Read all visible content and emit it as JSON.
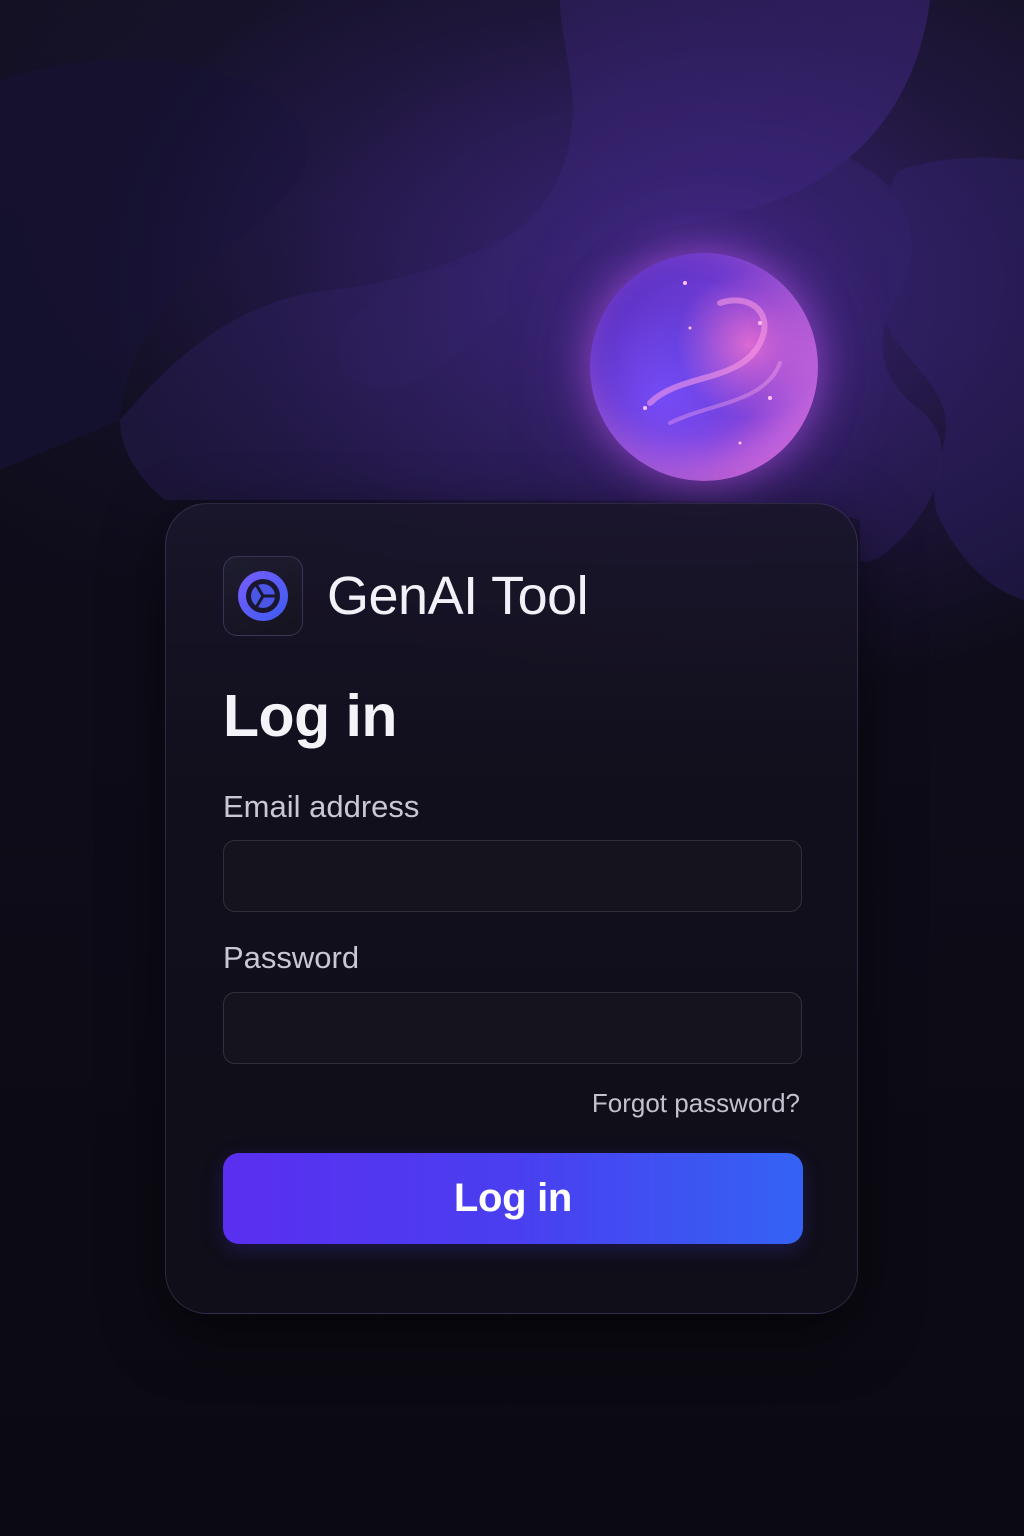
{
  "brand": {
    "name": "GenAI Tool",
    "logo_icon": "aperture-logo-icon"
  },
  "login_form": {
    "title": "Log in",
    "email_label": "Email address",
    "email_value": "",
    "password_label": "Password",
    "password_value": "",
    "forgot_password_link": "Forgot password?",
    "submit_label": "Log in"
  },
  "decor": {
    "orb_icon": "glowing-orb",
    "background": "abstract-waves"
  },
  "colors": {
    "background": "#0c0a14",
    "card": "#12101c",
    "accent_start": "#5a2ff0",
    "accent_end": "#3463f4",
    "orb_pink": "#d873e6",
    "orb_blue": "#5b3bd6",
    "text_primary": "#f4f3f8",
    "text_secondary": "#c9c7d3"
  }
}
